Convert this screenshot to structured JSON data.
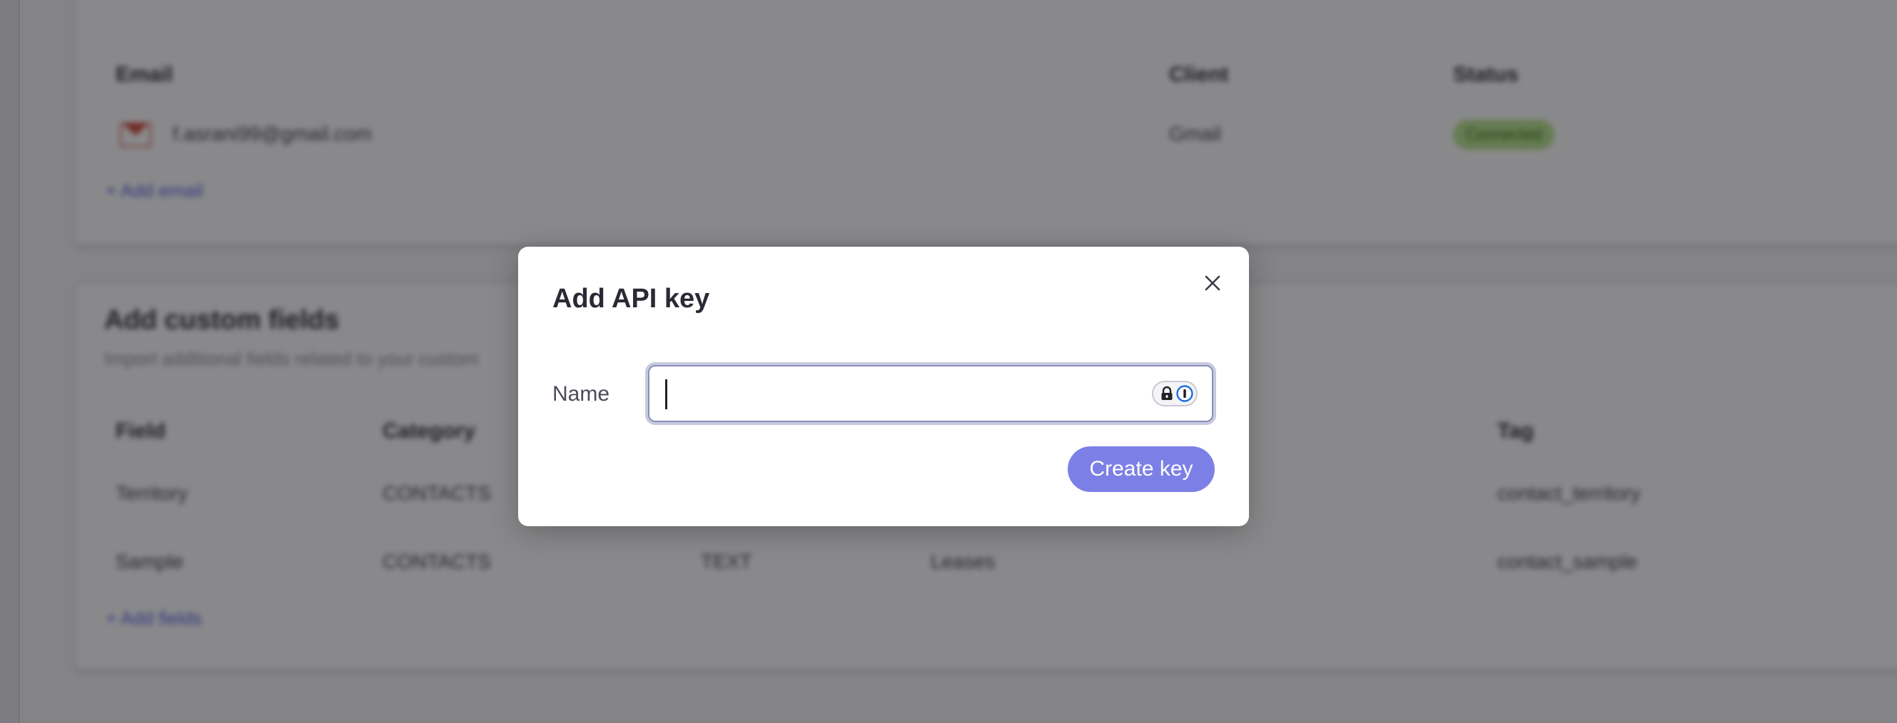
{
  "background": {
    "email_table": {
      "headers": [
        "Email",
        "Client",
        "Status"
      ],
      "rows": [
        {
          "email": "f.asrani99@gmail.com",
          "client": "Gmail",
          "status": "Connected"
        }
      ],
      "add_link": "+ Add email"
    },
    "custom_fields": {
      "title": "Add custom fields",
      "subtitle": "Import additional fields related to your custom",
      "headers": [
        "Field",
        "Category",
        "Tag"
      ],
      "rows": [
        {
          "field": "Territory",
          "category": "CONTACTS",
          "type": "",
          "owner": "",
          "tag": "contact_territory"
        },
        {
          "field": "Sample",
          "category": "CONTACTS",
          "type": "TEXT",
          "owner": "Leases",
          "tag": "contact_sample"
        }
      ],
      "add_link": "+ Add fields"
    }
  },
  "modal": {
    "title": "Add API key",
    "name_label": "Name",
    "name_value": "",
    "name_placeholder": "",
    "submit_label": "Create key"
  },
  "colors": {
    "accent": "#7c80e6",
    "overlay": "#7a7a7a",
    "status_connected": "#b7e38a"
  },
  "icons": {
    "close": "close-icon",
    "password_manager": "password-manager-icon",
    "lock": "lock-icon",
    "gmail": "gmail-icon"
  }
}
